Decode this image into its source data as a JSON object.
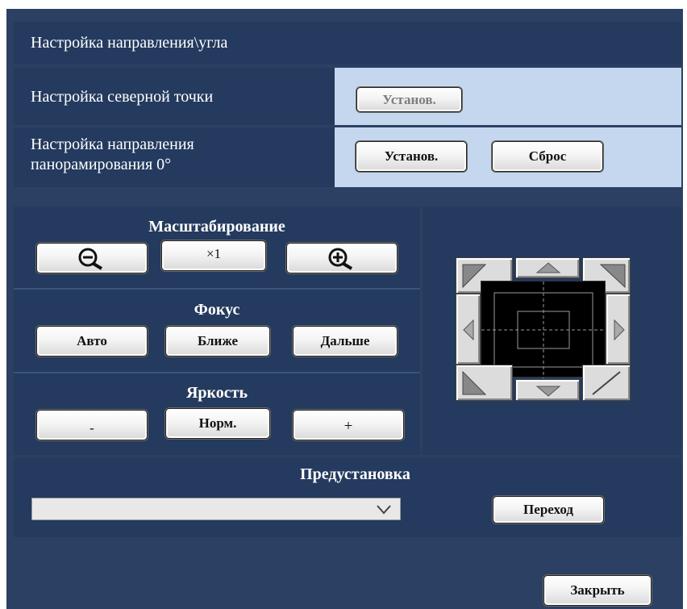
{
  "title": "Настройка направления\\угла",
  "north_point": {
    "label": "Настройка северной точки",
    "set_button": "Установ."
  },
  "pan_zero": {
    "label_line1": "Настройка направления",
    "label_line2": "панорамирования 0°",
    "set_button": "Установ.",
    "reset_button": "Сброс"
  },
  "zoom": {
    "heading": "Масштабирование",
    "x1_label": "×1"
  },
  "focus": {
    "heading": "Фокус",
    "auto": "Авто",
    "near": "Ближе",
    "far": "Дальше"
  },
  "brightness": {
    "heading": "Яркость",
    "minus": "-",
    "normal": "Норм.",
    "plus": "+"
  },
  "preset": {
    "heading": "Предустановка",
    "selected": "",
    "go_button": "Переход"
  },
  "close_button": "Закрыть",
  "colors": {
    "background": "#2c4063",
    "panel": "#243a5e",
    "light_cell": "#c4d7ef"
  }
}
